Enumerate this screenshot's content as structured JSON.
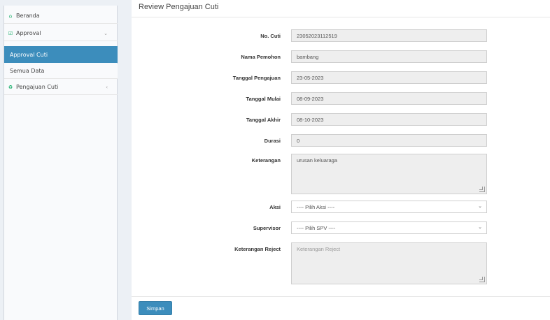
{
  "sidebar": {
    "items": [
      {
        "label": "Beranda",
        "icon": "home-icon"
      },
      {
        "label": "Approval",
        "icon": "check-square-icon"
      },
      {
        "label": "Approval Cuti",
        "icon": ""
      },
      {
        "label": "Semua Data",
        "icon": ""
      },
      {
        "label": "Pengajuan Cuti",
        "icon": "recycle-icon"
      }
    ]
  },
  "page": {
    "title": "Review Pengajuan Cuti"
  },
  "form": {
    "no_cuti": {
      "label": "No. Cuti",
      "value": "23052023112519"
    },
    "nama_pemohon": {
      "label": "Nama Pemohon",
      "value": "bambang"
    },
    "tanggal_pengajuan": {
      "label": "Tanggal Pengajuan",
      "value": "23-05-2023"
    },
    "tanggal_mulai": {
      "label": "Tanggal Mulai",
      "value": "08-09-2023"
    },
    "tanggal_akhir": {
      "label": "Tanggal Akhir",
      "value": "08-10-2023"
    },
    "durasi": {
      "label": "Durasi",
      "value": "0"
    },
    "keterangan": {
      "label": "Keterangan",
      "value": "urusan keluaraga"
    },
    "aksi": {
      "label": "Aksi",
      "selected": "---- Pilih Aksi ----"
    },
    "supervisor": {
      "label": "Supervisor",
      "selected": "---- Pilih SPV ----"
    },
    "keterangan_reject": {
      "label": "Keterangan Reject",
      "placeholder": "Keterangan Reject"
    }
  },
  "actions": {
    "save_label": "Simpan"
  },
  "colors": {
    "primary": "#3c8dbc",
    "green": "#00a65a"
  }
}
